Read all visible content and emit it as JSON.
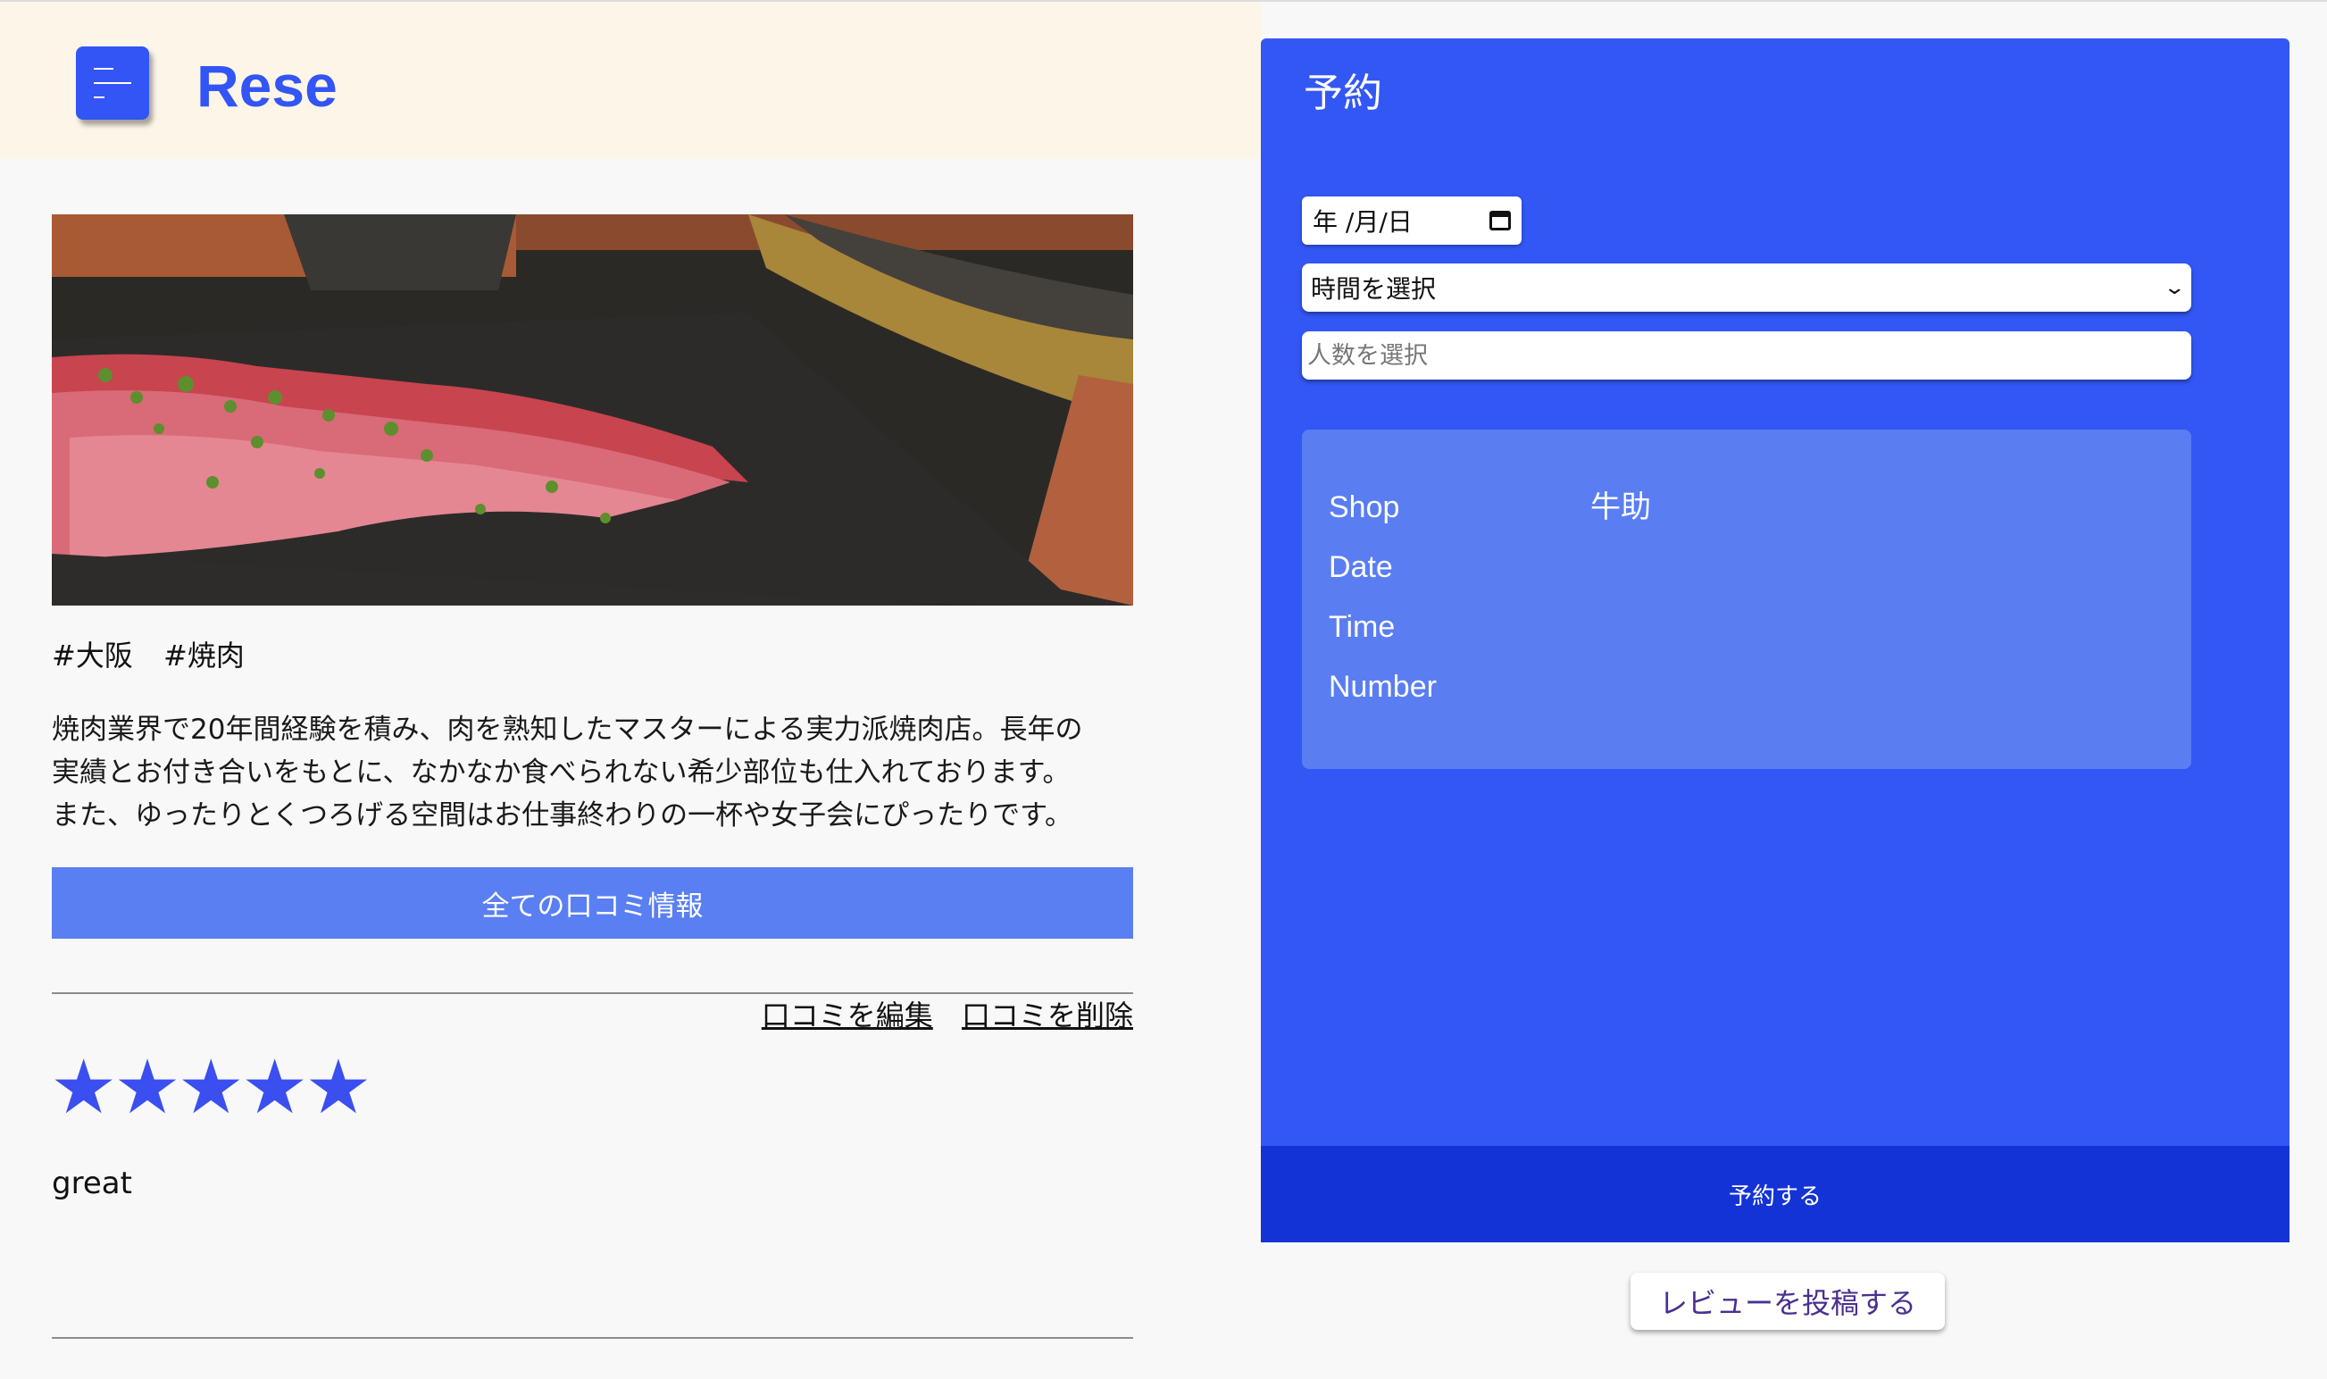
{
  "header": {
    "logo": "Rese",
    "menu_icon": "menu-icon"
  },
  "shop": {
    "image_alt": "焼肉の写真",
    "tags": [
      "#大阪",
      "#焼肉"
    ],
    "description_lines": [
      "焼肉業界で20年間経験を積み、肉を熟知したマスターによる実力派焼肉店。長年の",
      "実績とお付き合いをもとに、なかなか食べられない希少部位も仕入れております。",
      "また、ゆったりとくつろげる空間はお仕事終わりの一杯や女子会にぴったりです。"
    ],
    "all_reviews_label": "全ての口コミ情報"
  },
  "review": {
    "edit_label": "口コミを編集",
    "delete_label": "口コミを削除",
    "rating": 5,
    "star_glyphs": [
      "★",
      "★",
      "★",
      "★",
      "★"
    ],
    "comment": "great"
  },
  "reservation": {
    "title": "予約",
    "date_placeholder": "年 /月/日",
    "time_placeholder": "時間を選択",
    "people_placeholder": "人数を選択",
    "summary": {
      "shop_label": "Shop",
      "shop_value": "牛助",
      "date_label": "Date",
      "date_value": "",
      "time_label": "Time",
      "time_value": "",
      "number_label": "Number",
      "number_value": ""
    },
    "submit_label": "予約する"
  },
  "post_review_label": "レビューを投稿する",
  "colors": {
    "accent": "#3355f5",
    "panel": "#3357f5",
    "summary_box": "#5a7df2",
    "submit_bar": "#1433d6",
    "header_bg": "#fdf6e8",
    "page_bg": "#f8f8f8",
    "star": "#3b4ff0"
  }
}
